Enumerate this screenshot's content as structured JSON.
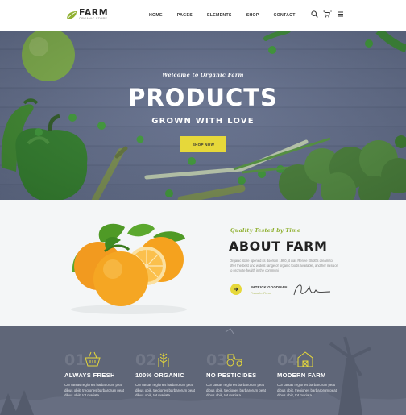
{
  "brand": {
    "name": "FARM",
    "tagline": "ORGANIC STORE",
    "accent": "#e6d83a",
    "green": "#8fb030"
  },
  "nav": {
    "items": [
      "HOME",
      "PAGES",
      "ELEMENTS",
      "SHOP",
      "CONTACT"
    ]
  },
  "header_icons": {
    "search": "search-icon",
    "cart": "cart-icon",
    "cart_count": "0",
    "menu": "menu-icon"
  },
  "hero": {
    "welcome": "Welcome to Organic Farm",
    "title": "PRODUCTS",
    "subtitle": "GROWN WITH LOVE",
    "button": "SHOP NOW"
  },
  "about": {
    "tag": "Quality Tested by Time",
    "title": "ABOUT FARM",
    "text": "Organic store opened its doors in 1990, it was Renée Elliott's dream to offer the best and widest range of organic foods available, and her mission to promote health in the communi",
    "founder_name": "PATRICK GOODMAN",
    "founder_role": "Founder Farm"
  },
  "features": [
    {
      "num": "01",
      "title": "ALWAYS FRESH",
      "text": "Cur tantas regiones barbarorum peat dibus obiit, tregiones barbarorum peat dibus obiit, tot mariata",
      "icon": "basket-icon"
    },
    {
      "num": "02",
      "title": "100% ORGANIC",
      "text": "Cur tantas regiones barbarorum peat dibus obiit, tregiones barbarorum peat dibus obiit, tot mariata",
      "icon": "wheat-icon"
    },
    {
      "num": "03",
      "title": "NO PESTICIDES",
      "text": "Cur tantas regiones barbarorum peat dibus obiit, tregiones barbarorum peat dibus obiit, tot mariata",
      "icon": "tractor-icon"
    },
    {
      "num": "04",
      "title": "MODERN FARM",
      "text": "Cur tantas regiones barbarorum peat dibus obiit, tregiones barbarorum peat dibus obiit, tot mariata",
      "icon": "barn-icon"
    }
  ]
}
